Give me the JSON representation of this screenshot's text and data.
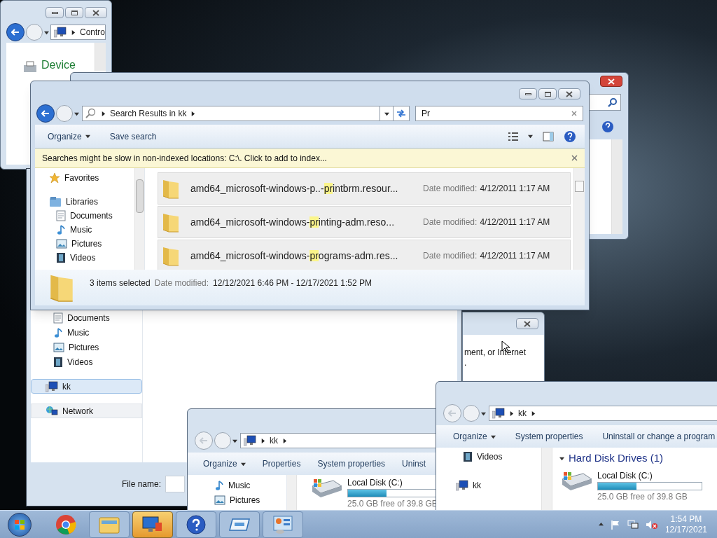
{
  "control_panel_window": {
    "address": [
      "Contro"
    ],
    "heading": "Device"
  },
  "save_dialog": {
    "nav_items": [
      {
        "label": "Documents",
        "selected": false
      },
      {
        "label": "Music",
        "selected": false
      },
      {
        "label": "Pictures",
        "selected": false
      },
      {
        "label": "Videos",
        "selected": false
      },
      {
        "label": "kk",
        "selected": true
      },
      {
        "label": "Network",
        "selected": false
      }
    ],
    "file_name_label": "File name:"
  },
  "message_dialog": {
    "lines": [
      "ment, or Internet",
      "."
    ]
  },
  "search_window": {
    "address": [
      "Search Results in kk"
    ],
    "search_value": "Pr",
    "toolbar": [
      "Organize",
      "Save search"
    ],
    "info_bar": "Searches might be slow in non-indexed locations: C:\\. Click to add to index...",
    "nav_items": [
      {
        "label": "Favorites"
      },
      {
        "label": "Libraries"
      },
      {
        "label": "Documents"
      },
      {
        "label": "Music"
      },
      {
        "label": "Pictures"
      },
      {
        "label": "Videos"
      }
    ],
    "results": [
      {
        "before": "amd64_microsoft-windows-p..-",
        "match": "pr",
        "after": "intbrm.resour...",
        "date_label": "Date modified:",
        "date": "4/12/2011 1:17 AM",
        "selected": true
      },
      {
        "before": "amd64_microsoft-windows-",
        "match": "pr",
        "after": "inting-adm.reso...",
        "date_label": "Date modified:",
        "date": "4/12/2011 1:17 AM",
        "selected": true
      },
      {
        "before": "amd64_microsoft-windows-",
        "match": "pr",
        "after": "ograms-adm.res...",
        "date_label": "Date modified:",
        "date": "4/12/2011 1:17 AM",
        "selected": true
      }
    ],
    "details": {
      "count": "3 items selected",
      "date_label": "Date modified:",
      "date": "12/12/2021 6:46 PM - 12/17/2021 1:52 PM"
    }
  },
  "computer_window_left": {
    "address": [
      "kk"
    ],
    "toolbar": [
      "Organize",
      "Properties",
      "System properties",
      "Uninst"
    ],
    "nav_items": [
      {
        "label": "Music"
      },
      {
        "label": "Pictures"
      }
    ],
    "drive": {
      "name": "Local Disk (C:)",
      "level": 0.37,
      "free": "25.0 GB free of 39.8 GB"
    }
  },
  "computer_window_right": {
    "address": [
      "kk"
    ],
    "toolbar": [
      "Organize",
      "System properties",
      "Uninstall or change a program"
    ],
    "nav_items": [
      {
        "label": "Videos"
      },
      {
        "label": "kk"
      }
    ],
    "group_heading": "Hard Disk Drives (1)",
    "drive": {
      "name": "Local Disk (C:)",
      "level": 0.37,
      "free": "25.0 GB free of 39.8 GB"
    }
  },
  "taskbar": {
    "items": [
      {
        "kind": "chrome",
        "active": false
      },
      {
        "kind": "explorer",
        "active": false
      },
      {
        "kind": "remote",
        "active": true
      },
      {
        "kind": "help",
        "active": false
      },
      {
        "kind": "window",
        "active": false
      },
      {
        "kind": "control",
        "active": false
      }
    ],
    "time": "1:54 PM",
    "date": "12/17/2021"
  }
}
